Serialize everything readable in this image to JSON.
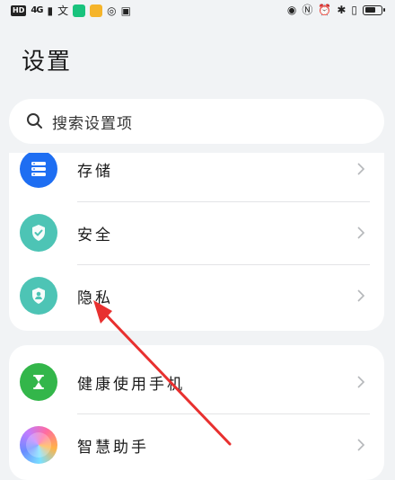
{
  "status_bar": {
    "left": [
      "HD",
      "4G",
      "文"
    ],
    "battery_level": 0.7
  },
  "page": {
    "title": "设置"
  },
  "search": {
    "placeholder": "搜索设置项"
  },
  "group1": {
    "items": [
      {
        "label": "存储",
        "icon": "storage-icon",
        "color": "#1e6ef2"
      },
      {
        "label": "安全",
        "icon": "shield-check-icon",
        "color": "#4dc4b5"
      },
      {
        "label": "隐私",
        "icon": "privacy-icon",
        "color": "#4dc4b5"
      }
    ]
  },
  "group2": {
    "items": [
      {
        "label": "健康使用手机",
        "icon": "hourglass-icon",
        "color": "#33b64a"
      },
      {
        "label": "智慧助手",
        "icon": "smart-assistant-icon",
        "color": "#b57cf5"
      }
    ]
  },
  "annotation": {
    "color": "#e8302f"
  }
}
